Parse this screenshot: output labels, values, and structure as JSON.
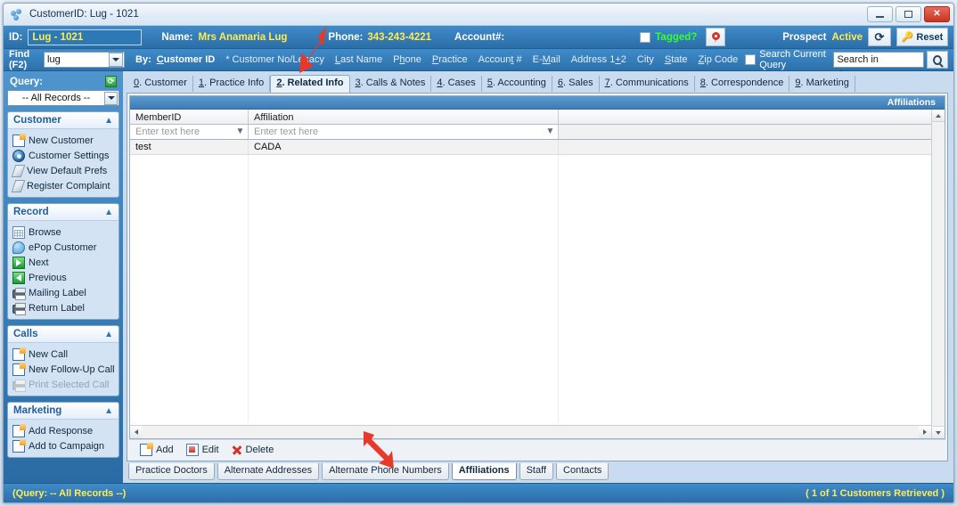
{
  "window": {
    "title": "CustomerID: Lug - 1021",
    "icon": "app-dots-icon",
    "controls": {
      "minimize": "minimize",
      "maximize": "maximize",
      "close": "close"
    }
  },
  "header": {
    "id_label": "ID:",
    "id_value": "Lug - 1021",
    "name_label": "Name:",
    "name_value": "Mrs Anamaria Lug",
    "phone_label": "Phone:",
    "phone_value": "343-243-4221",
    "account_label": "Account#:",
    "account_value": "",
    "tagged_label": "Tagged?",
    "tagged_checked": false,
    "map_pin_icon": "map-pin-icon",
    "prospect_label": "Prospect",
    "prospect_status": "Active",
    "refresh_label": "⟳",
    "reset_label": "Reset"
  },
  "find": {
    "label": "Find (F2)",
    "value": "lug",
    "by_label": "By:",
    "by_options": [
      {
        "label": "Customer ID",
        "selected": true
      },
      {
        "label": "* Customer No/Legacy",
        "selected": false
      },
      {
        "label": "Last Name",
        "selected": false
      },
      {
        "label": "Phone",
        "selected": false
      },
      {
        "label": "Practice",
        "selected": false
      },
      {
        "label": "Account #",
        "selected": false
      },
      {
        "label": "E-Mail",
        "selected": false
      },
      {
        "label": "Address 1+2",
        "selected": false
      },
      {
        "label": "City",
        "selected": false
      },
      {
        "label": "State",
        "selected": false
      },
      {
        "label": "Zip Code",
        "selected": false
      }
    ],
    "search_current_query_label": "Search Current Query",
    "search_current_query_checked": false,
    "search_placeholder": "Search in Customer",
    "search_value": "Search in Customer",
    "search_icon": "magnifier-icon"
  },
  "sidebar": {
    "query_title": "Query:",
    "query_refresh_icon": "refresh-icon",
    "query_value": "-- All Records --",
    "groups": [
      {
        "title": "Customer",
        "items": [
          {
            "label": "New Customer",
            "icon": "new-document-icon",
            "disabled": false
          },
          {
            "label": "Customer Settings",
            "icon": "gear-icon",
            "disabled": false
          },
          {
            "label": "View Default Prefs",
            "icon": "prefs-icon",
            "disabled": false
          },
          {
            "label": "Register Complaint",
            "icon": "prefs-icon",
            "disabled": false
          }
        ]
      },
      {
        "title": "Record",
        "items": [
          {
            "label": "Browse",
            "icon": "grid-icon",
            "disabled": false
          },
          {
            "label": "ePop Customer",
            "icon": "bubble-icon",
            "disabled": false
          },
          {
            "label": "Next",
            "icon": "next-arrow-icon",
            "disabled": false
          },
          {
            "label": "Previous",
            "icon": "previous-arrow-icon",
            "disabled": false
          },
          {
            "label": "Mailing Label",
            "icon": "printer-icon",
            "disabled": false
          },
          {
            "label": "Return Label",
            "icon": "printer-icon",
            "disabled": false
          }
        ]
      },
      {
        "title": "Calls",
        "items": [
          {
            "label": "New Call",
            "icon": "new-document-icon",
            "disabled": false
          },
          {
            "label": "New Follow-Up Call",
            "icon": "new-document-icon",
            "disabled": false
          },
          {
            "label": "Print Selected Call",
            "icon": "printer-icon",
            "disabled": true
          }
        ]
      },
      {
        "title": "Marketing",
        "items": [
          {
            "label": "Add Response",
            "icon": "new-document-icon",
            "disabled": false
          },
          {
            "label": "Add to Campaign",
            "icon": "new-document-icon",
            "disabled": false
          }
        ]
      }
    ]
  },
  "main_tabs": [
    {
      "label": "0. Customer",
      "active": false
    },
    {
      "label": "1. Practice Info",
      "active": false
    },
    {
      "label": "2. Related Info",
      "active": true
    },
    {
      "label": "3. Calls & Notes",
      "active": false
    },
    {
      "label": "4. Cases",
      "active": false
    },
    {
      "label": "5. Accounting",
      "active": false
    },
    {
      "label": "6. Sales",
      "active": false
    },
    {
      "label": "7. Communications",
      "active": false
    },
    {
      "label": "8. Correspondence",
      "active": false
    },
    {
      "label": "9. Marketing",
      "active": false
    }
  ],
  "grid": {
    "caption": "Affiliations",
    "columns": [
      {
        "label": "MemberID",
        "filter_placeholder": "Enter text here",
        "filter_icon": "funnel-icon"
      },
      {
        "label": "Affiliation",
        "filter_placeholder": "Enter text here",
        "filter_icon": "funnel-icon"
      }
    ],
    "rows": [
      {
        "MemberID": "test",
        "Affiliation": "CADA"
      }
    ]
  },
  "actions": [
    {
      "label": "Add",
      "icon": "new-document-icon"
    },
    {
      "label": "Edit",
      "icon": "edit-document-icon"
    },
    {
      "label": "Delete",
      "icon": "delete-x-icon"
    }
  ],
  "sub_tabs": [
    {
      "label": "Practice Doctors",
      "active": false
    },
    {
      "label": "Alternate Addresses",
      "active": false
    },
    {
      "label": "Alternate Phone Numbers",
      "active": false
    },
    {
      "label": "Affiliations",
      "active": true
    },
    {
      "label": "Staff",
      "active": false
    },
    {
      "label": "Contacts",
      "active": false
    }
  ],
  "statusbar": {
    "left": "(Query: -- All Records --)",
    "right": "( 1 of 1 Customers Retrieved )"
  },
  "annotations": [
    {
      "name": "arrow-pointing-to-related-info-tab",
      "color": "#e8382a"
    },
    {
      "name": "arrow-pointing-to-affiliations-subtab",
      "color": "#e8382a"
    }
  ],
  "colors": {
    "header_blue": "#3f8bc9",
    "accent_yellow": "#ffec4f",
    "status_green": "#33ff33",
    "annotation_red": "#e8382a"
  }
}
